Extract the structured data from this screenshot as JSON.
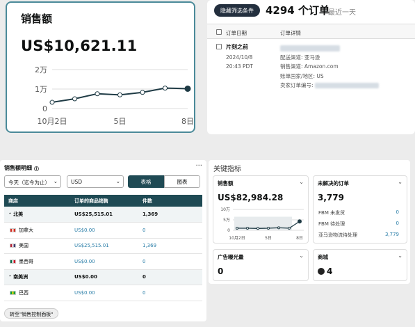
{
  "sales_card": {
    "title": "销售额",
    "value": "US$10,621.11",
    "y_ticks": [
      "2万",
      "1万",
      "0"
    ],
    "x_ticks": [
      "10月2日",
      "5日",
      "8日"
    ],
    "line_points": [
      0.32,
      0.5,
      0.76,
      0.7,
      0.83,
      1.05,
      1.02
    ]
  },
  "orders": {
    "filter_label": "隐藏筛选条件",
    "count": "4294 个订单",
    "range": "最近一天",
    "headers": {
      "date": "订单日期",
      "detail": "订单详情"
    },
    "row": {
      "relative": "片刻之前",
      "date": "2024/10/8",
      "time": "20:43 PDT",
      "lines": [
        "配送渠道: 亚马逊",
        "销售渠道: Amazon.com",
        "账单国家/地区: US",
        "卖家订单编号:"
      ]
    }
  },
  "detail": {
    "title": "销售额明细",
    "info_icon": "info-icon",
    "more": "···",
    "date_select": "今天（迄今为止）",
    "currency_select": "USD",
    "toggle_table": "表格",
    "toggle_chart": "图表",
    "headers": [
      "商店",
      "订单的商品销售",
      "件数"
    ],
    "rows": [
      {
        "name": "北美",
        "sales": "US$25,515.01",
        "units": "1,369",
        "type": "region"
      },
      {
        "name": "加拿大",
        "sales": "US$0.00",
        "units": "0",
        "type": "country",
        "flag": "ca"
      },
      {
        "name": "美国",
        "sales": "US$25,515.01",
        "units": "1,369",
        "type": "country",
        "flag": "us"
      },
      {
        "name": "墨西哥",
        "sales": "US$0.00",
        "units": "0",
        "type": "country",
        "flag": "mx"
      },
      {
        "name": "南美洲",
        "sales": "US$0.00",
        "units": "0",
        "type": "region"
      },
      {
        "name": "巴西",
        "sales": "US$0.00",
        "units": "0",
        "type": "country",
        "flag": "br"
      }
    ],
    "goto": "转至\"销售控制面板\""
  },
  "kpi": {
    "title": "关键指标",
    "sales": {
      "label": "销售额",
      "value": "US$82,984.28",
      "y_ticks": [
        "10万",
        "5万",
        "0"
      ],
      "x_ticks": [
        "10月2日",
        "5日",
        "8日"
      ],
      "line_points": [
        0.2,
        0.2,
        0.18,
        0.2,
        0.24,
        0.2,
        0.85
      ]
    },
    "orders": {
      "label": "未解决的订单",
      "value": "3,779",
      "fbm_unshipped_label": "FBM 未发货",
      "fbm_unshipped": "0",
      "fbm_pending_label": "FBM 待处理",
      "fbm_pending": "0",
      "afn_label": "亚马逊物流待处理",
      "afn": "3,779"
    },
    "ads": {
      "label": "广告曝光量",
      "value": "0"
    },
    "stores": {
      "label": "商城",
      "value": "4"
    }
  },
  "colors": {
    "accent": "#1f4a54",
    "link": "#2a7ea8",
    "line": "#1f3b45"
  }
}
